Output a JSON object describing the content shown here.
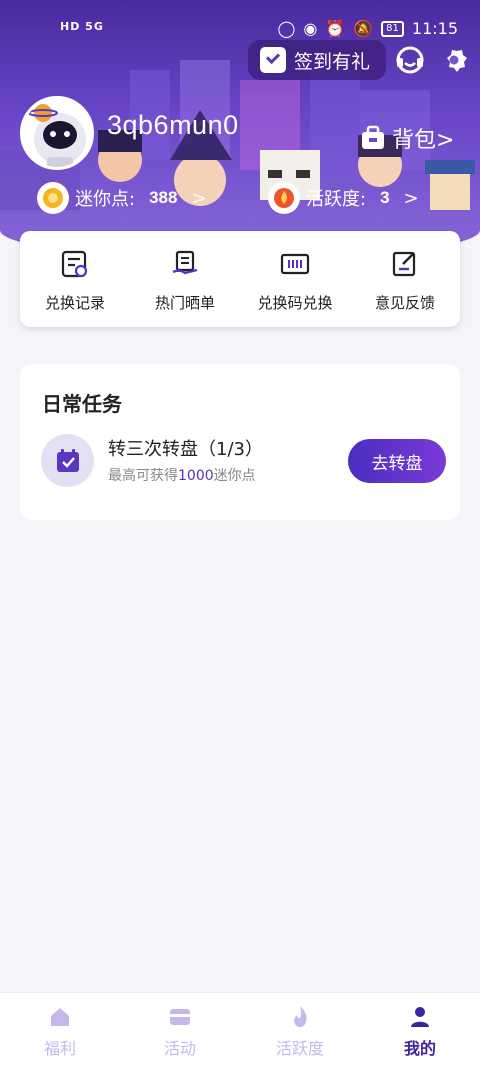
{
  "status_bar": {
    "network_text": "HD 5G",
    "battery": "81",
    "time": "11:15"
  },
  "header": {
    "signin_label": "签到有礼",
    "username": "3qb6mun0",
    "bag_label": "背包>",
    "coins_label": "迷你点:",
    "coins_value": "388",
    "activity_label": "活跃度:",
    "activity_value": "3",
    "arrow": ">"
  },
  "actions": [
    {
      "label": "兑换记录",
      "icon": "record-icon"
    },
    {
      "label": "热门晒单",
      "icon": "clipboard-hand-icon"
    },
    {
      "label": "兑换码兑换",
      "icon": "barcode-icon"
    },
    {
      "label": "意见反馈",
      "icon": "feedback-icon"
    }
  ],
  "tasks": {
    "title": "日常任务",
    "items": [
      {
        "name": "转三次转盘（1/3）",
        "desc_prefix": "最高可获得",
        "desc_amount": "1000",
        "desc_suffix": "迷你点",
        "button": "去转盘"
      }
    ]
  },
  "bottom_nav": {
    "items": [
      {
        "label": "福利",
        "icon": "home-icon"
      },
      {
        "label": "活动",
        "icon": "card-icon"
      },
      {
        "label": "活跃度",
        "icon": "flame-icon"
      },
      {
        "label": "我的",
        "icon": "person-icon"
      }
    ],
    "active_index": 3
  },
  "colors": {
    "accent": "#3d23a0",
    "header_gradient_top": "#4a2a9e",
    "button_gradient": "#5a2fc8"
  }
}
